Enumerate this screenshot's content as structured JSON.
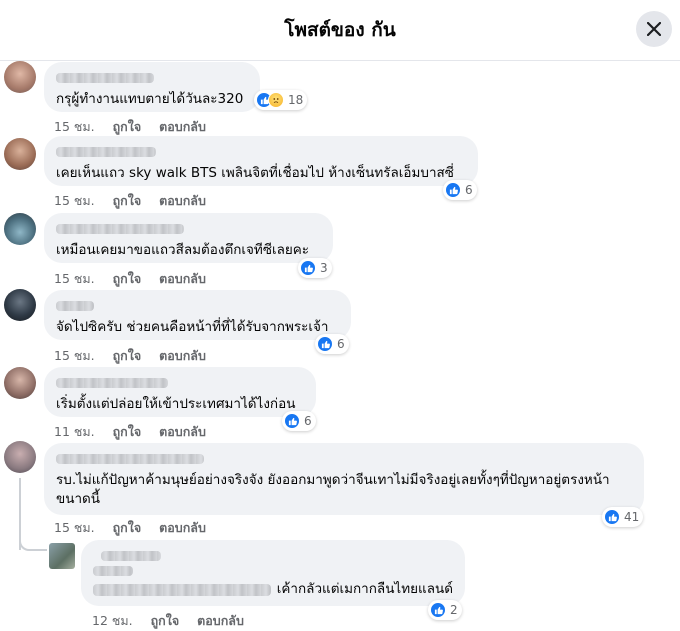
{
  "header": {
    "title": "โพสต์ของ กัน"
  },
  "actions": {
    "like": "ถูกใจ",
    "reply": "ตอบกลับ"
  },
  "comments": [
    {
      "text": "กรุผู้ทำงานแทบตายได้วันละ320",
      "time": "15 ชม.",
      "reaction_count": "18",
      "reactions": [
        "like",
        "sad"
      ]
    },
    {
      "text": "เคยเห็นแถว sky walk BTS เพลินจิตที่เชื่อมไป ห้างเซ็นทรัลเอ็มบาสซี่",
      "time": "15 ชม.",
      "reaction_count": "6",
      "reactions": [
        "like"
      ]
    },
    {
      "text": "เหมือนเคยมาขอแถวสีลมต้องตึกเจทีซีเลยคะ",
      "time": "15 ชม.",
      "reaction_count": "3",
      "reactions": [
        "like"
      ]
    },
    {
      "text": "จัดไปซิครับ ช่วยคนคือหน้าที่ที่ได้รับจากพระเจ้า",
      "time": "15 ชม.",
      "reaction_count": "6",
      "reactions": [
        "like"
      ]
    },
    {
      "text": "เริ่มตั้งแต่ปล่อยให้เข้าประเทศมาได้ไงก่อน",
      "time": "11 ชม.",
      "reaction_count": "6",
      "reactions": [
        "like"
      ]
    },
    {
      "text": "รบ.ไม่แก้ปัญหาค้ามนุษย์อย่างจริงจัง ยังออกมาพูดว่าจีนเทาไม่มีจริงอยู่เลยทั้งๆที่ปัญหาอยู่ตรงหน้าขนาดนี้",
      "time": "15 ชม.",
      "reaction_count": "41",
      "reactions": [
        "like"
      ]
    },
    {
      "text": "เค้ากลัวแต่เมกากลืนไทยแลนด์",
      "time": "12 ชม.",
      "reaction_count": "2",
      "reactions": [
        "like"
      ]
    }
  ],
  "colors": {
    "accent": "#1877f2",
    "bubble": "#f0f2f5",
    "meta": "#65676b"
  }
}
